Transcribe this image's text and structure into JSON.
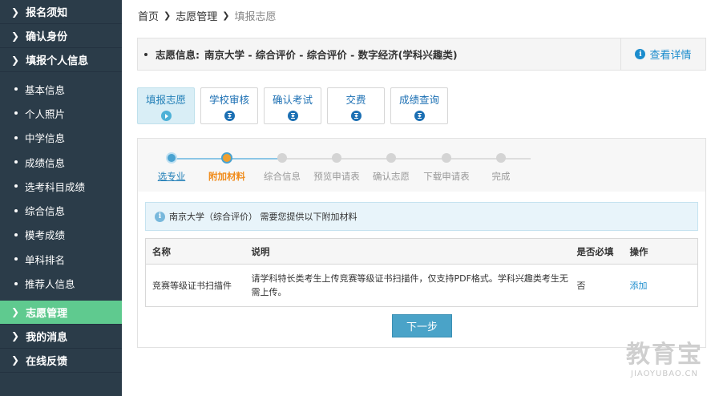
{
  "sidebar": {
    "top_items": [
      {
        "label": "报名须知"
      },
      {
        "label": "确认身份"
      },
      {
        "label": "填报个人信息"
      }
    ],
    "sub_items": [
      {
        "label": "基本信息"
      },
      {
        "label": "个人照片"
      },
      {
        "label": "中学信息"
      },
      {
        "label": "成绩信息"
      },
      {
        "label": "选考科目成绩"
      },
      {
        "label": "综合信息"
      },
      {
        "label": "模考成绩"
      },
      {
        "label": "单科排名"
      },
      {
        "label": "推荐人信息"
      }
    ],
    "bottom_items": [
      {
        "label": "志愿管理",
        "active": true
      },
      {
        "label": "我的消息"
      },
      {
        "label": "在线反馈"
      }
    ],
    "active_color": "#5fca8f",
    "bg_color": "#2b3c49"
  },
  "breadcrumb": {
    "home": "首页",
    "section": "志愿管理",
    "current": "填报志愿"
  },
  "infobar": {
    "label": "志愿信息:",
    "value": "南京大学 - 综合评价 - 综合评价 - 数字经济(学科兴趣类)",
    "detail_link": "查看详情"
  },
  "tabs": [
    {
      "label": "填报志愿",
      "active": true
    },
    {
      "label": "学校审核"
    },
    {
      "label": "确认考试"
    },
    {
      "label": "交费"
    },
    {
      "label": "成绩查询"
    }
  ],
  "steps": [
    {
      "label": "选专业",
      "state": "done"
    },
    {
      "label": "附加材料",
      "state": "current"
    },
    {
      "label": "综合信息",
      "state": "todo"
    },
    {
      "label": "预览申请表",
      "state": "todo"
    },
    {
      "label": "确认志愿",
      "state": "todo"
    },
    {
      "label": "下载申请表",
      "state": "todo"
    },
    {
      "label": "完成",
      "state": "todo"
    }
  ],
  "notice": {
    "text": "南京大学（综合评价） 需要您提供以下附加材料"
  },
  "table": {
    "headers": {
      "name": "名称",
      "desc": "说明",
      "required": "是否必填",
      "action": "操作"
    },
    "rows": [
      {
        "name": "竞赛等级证书扫描件",
        "desc_line1": "请学科特长类考生上传竞赛等级证书扫描件，仅支持PDF格式。学科兴趣类考生无",
        "desc_line2": "需上传。",
        "required": "否",
        "action": "添加"
      }
    ]
  },
  "next_button": "下一步",
  "watermark": {
    "big": "教育宝",
    "small": "JIAOYUBAO.CN"
  }
}
